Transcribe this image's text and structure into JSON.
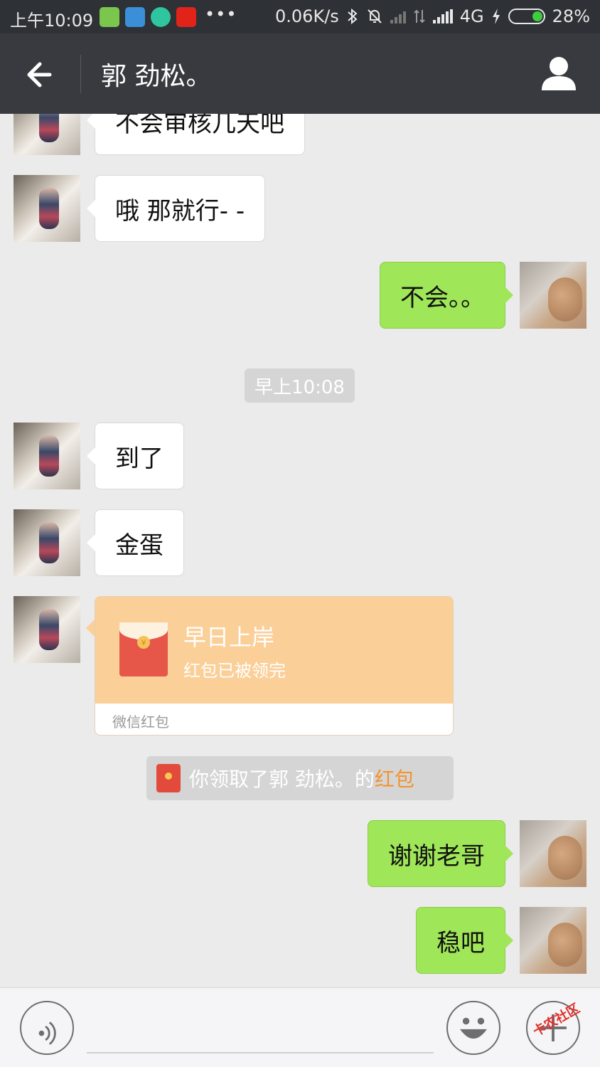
{
  "status_bar": {
    "time": "上午10:09",
    "more": "•••",
    "network_speed": "0.06K/s",
    "network_type": "4G",
    "battery": "28%"
  },
  "header": {
    "title": "郭 劲松。"
  },
  "messages": [
    {
      "side": "left",
      "text": "不会审核几天吧"
    },
    {
      "side": "left",
      "text": "哦 那就行- -"
    },
    {
      "side": "right",
      "text": "不会。。"
    },
    {
      "side": "left",
      "text": "到了"
    },
    {
      "side": "left",
      "text": "金蛋"
    },
    {
      "side": "right",
      "text": "谢谢老哥"
    },
    {
      "side": "right",
      "text": "稳吧"
    }
  ],
  "timestamp": "早上10:08",
  "red_packet": {
    "title": "早日上岸",
    "status": "红包已被领完",
    "footer": "微信红包"
  },
  "notice": {
    "prefix": "你领取了郭 劲松。的",
    "highlight": "红包"
  },
  "watermark": "卡农社区",
  "colors": {
    "header_bg": "#393a3f",
    "my_bubble": "#9fe658",
    "their_bubble": "#ffffff",
    "packet_bg": "#fbcf98",
    "highlight": "#f2932c"
  }
}
